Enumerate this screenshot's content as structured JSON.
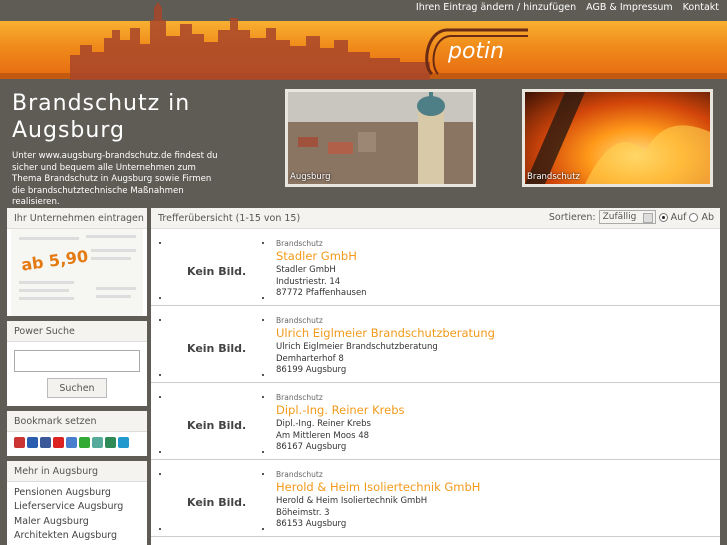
{
  "topnav": [
    {
      "label": "Ihren Eintrag ändern / hinzufügen"
    },
    {
      "label": "AGB & Impressum"
    },
    {
      "label": "Kontakt"
    }
  ],
  "logo": {
    "text": "potin"
  },
  "hero": {
    "title": "Brandschutz in Augsburg",
    "description": "Unter www.augsburg-brandschutz.de findest du sicher und bequem alle Unternehmen zum Thema Brandschutz in Augsburg sowie Firmen die brandschutztechnische Maßnahmen realisieren.",
    "photo1_caption": "Augsburg",
    "photo2_caption": "Brandschutz"
  },
  "sidebar": {
    "eintragen_title": "Ihr Unternehmen eintragen",
    "promo_price": "ab 5,90",
    "search_title": "Power Suche",
    "search_value": "",
    "search_button": "Suchen",
    "bookmark_title": "Bookmark setzen",
    "bookmark_icons": [
      {
        "name": "bookmark-icon-1",
        "color": "#c33"
      },
      {
        "name": "bookmark-icon-2",
        "color": "#2a5db0"
      },
      {
        "name": "bookmark-icon-3",
        "color": "#3b5998"
      },
      {
        "name": "bookmark-icon-4",
        "color": "#d22"
      },
      {
        "name": "bookmark-icon-5",
        "color": "#4a7fd0"
      },
      {
        "name": "bookmark-icon-6",
        "color": "#3a3"
      },
      {
        "name": "bookmark-icon-7",
        "color": "#5a9"
      },
      {
        "name": "bookmark-icon-8",
        "color": "#2e8b57"
      },
      {
        "name": "bookmark-icon-9",
        "color": "#29c"
      }
    ],
    "mehr_title": "Mehr in Augsburg",
    "mehr_links": [
      {
        "label": "Pensionen Augsburg"
      },
      {
        "label": "Lieferservice Augsburg"
      },
      {
        "label": "Maler Augsburg"
      },
      {
        "label": "Architekten Augsburg"
      }
    ]
  },
  "main": {
    "count": "Trefferübersicht (1-15 von 15)",
    "sort_label": "Sortieren:",
    "sort_value": "Zufällig",
    "sort_asc": "Auf",
    "sort_desc": "Ab",
    "entries": [
      {
        "noimg": "Kein Bild.",
        "category": "Brandschutz",
        "name": "Stadler GmbH",
        "line1": "Stadler GmbH",
        "line2": "Industriestr. 14",
        "line3": "87772 Pfaffenhausen"
      },
      {
        "noimg": "Kein Bild.",
        "category": "Brandschutz",
        "name": "Ulrich Eiglmeier Brandschutzberatung",
        "line1": "Ulrich Eiglmeier Brandschutzberatung",
        "line2": "Demharterhof 8",
        "line3": "86199 Augsburg"
      },
      {
        "noimg": "Kein Bild.",
        "category": "Brandschutz",
        "name": "Dipl.-Ing. Reiner Krebs",
        "line1": "Dipl.-Ing. Reiner Krebs",
        "line2": "Am Mittleren Moos 48",
        "line3": "86167 Augsburg"
      },
      {
        "noimg": "Kein Bild.",
        "category": "Brandschutz",
        "name": "Herold & Heim Isoliertechnik GmbH",
        "line1": "Herold & Heim Isoliertechnik GmbH",
        "line2": "Böheimstr. 3",
        "line3": "86153 Augsburg"
      }
    ]
  },
  "colors": {
    "accent": "#f39a1b",
    "banner": "#f08a1a",
    "background": "#5e5c55"
  }
}
